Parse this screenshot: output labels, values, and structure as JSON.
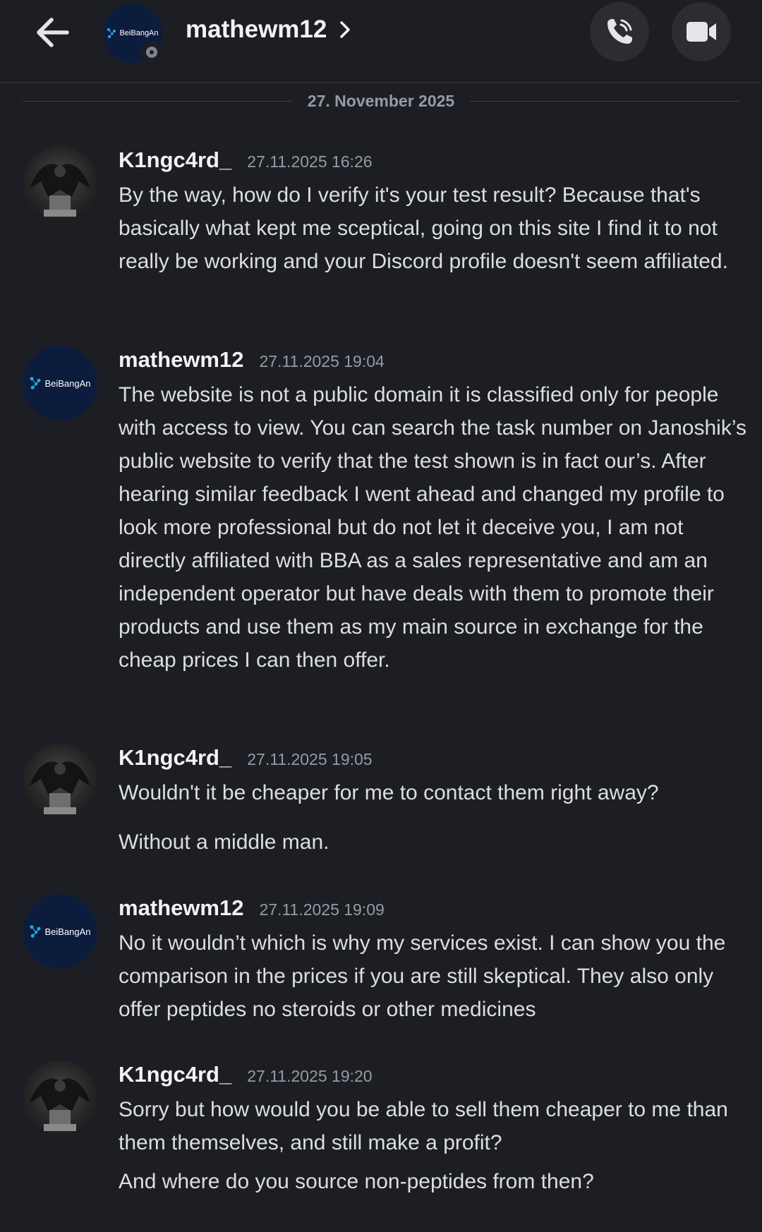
{
  "header": {
    "title": "mathewm12",
    "avatar_text": "BeiBangAn"
  },
  "date_divider": "27. November 2025",
  "messages": [
    {
      "author": "K1ngc4rd_",
      "time": "27.11.2025 16:26",
      "avatar": "dark-statue",
      "texts": [
        "By the way, how do I verify it's your test result? Because that's basically what kept me sceptical, going on this site I find it to not really be working and your Discord profile doesn't seem affiliated."
      ]
    },
    {
      "author": "mathewm12",
      "time": "27.11.2025 19:04",
      "avatar": "BeiBangAn",
      "texts": [
        "The website is not a public domain it is classified only for people with access to view. You can search the task number on Janoshik’s public website to verify that the test shown is in fact our’s. After hearing similar feedback I went ahead and changed my profile to look more professional but do not let it deceive you, I am not directly affiliated with BBA as a sales representative and am an independent operator but have deals with them to promote their products and use them as my main source in exchange for the cheap prices I can then offer."
      ]
    },
    {
      "author": "K1ngc4rd_",
      "time": "27.11.2025 19:05",
      "avatar": "dark-statue",
      "texts": [
        "Wouldn't it be cheaper for me to contact them right away?",
        "Without a middle man."
      ]
    },
    {
      "author": "mathewm12",
      "time": "27.11.2025 19:09",
      "avatar": "BeiBangAn",
      "texts": [
        "No it wouldn’t which is why my services exist. I can show you the comparison in the prices if you are still skeptical. They also only offer peptides no steroids or other medicines"
      ]
    },
    {
      "author": "K1ngc4rd_",
      "time": "27.11.2025 19:20",
      "avatar": "dark-statue",
      "texts": [
        "Sorry but how would you be able to sell them cheaper to me than them themselves, and still make a profit?",
        "And where do you source non-peptides from then?"
      ]
    }
  ],
  "icons": {
    "back": "arrow-left-icon",
    "chevron": "chevron-right-icon",
    "call": "phone-call-icon",
    "video": "video-camera-icon",
    "status": "idle-status-icon"
  },
  "colors": {
    "background": "#1d1e23",
    "text": "#dbdee1",
    "muted": "#949ba4",
    "button_bg": "#2b2d33",
    "brand_avatar": "#0c1c3d",
    "brand_accent": "#29a8e0"
  }
}
